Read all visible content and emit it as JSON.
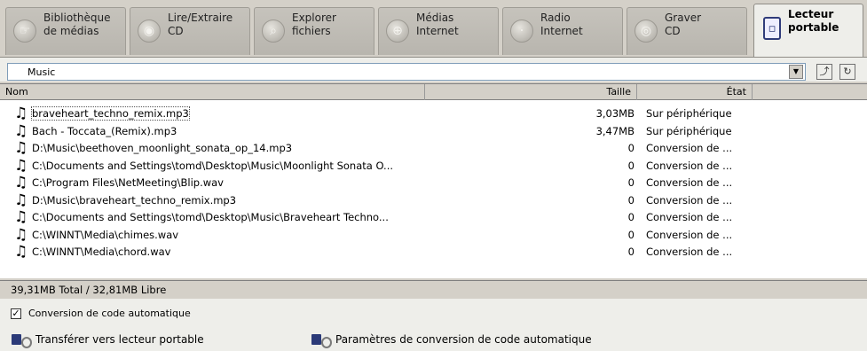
{
  "tabs": [
    {
      "line1": "Bibliothèque",
      "line2": "de médias",
      "icon": "hand-icon"
    },
    {
      "line1": "Lire/Extraire",
      "line2": "CD",
      "icon": "cd-icon"
    },
    {
      "line1": "Explorer",
      "line2": "fichiers",
      "icon": "search-icon"
    },
    {
      "line1": "Médias",
      "line2": "Internet",
      "icon": "globe-icon"
    },
    {
      "line1": "Radio",
      "line2": "Internet",
      "icon": "radio-icon"
    },
    {
      "line1": "Graver",
      "line2": "CD",
      "icon": "burn-cd-icon"
    },
    {
      "line1": "Lecteur",
      "line2": "portable",
      "icon": "portable-player-icon",
      "active": true
    }
  ],
  "folder": {
    "value": "Music"
  },
  "columns": {
    "name": "Nom",
    "size": "Taille",
    "state": "État"
  },
  "rows": [
    {
      "name": "braveheart_techno_remix.mp3",
      "size": "3,03MB",
      "state": "Sur périphérique"
    },
    {
      "name": "Bach - Toccata_(Remix).mp3",
      "size": "3,47MB",
      "state": "Sur périphérique"
    },
    {
      "name": "D:\\Music\\beethoven_moonlight_sonata_op_14.mp3",
      "size": "0",
      "state": "Conversion de ..."
    },
    {
      "name": "C:\\Documents and Settings\\tomd\\Desktop\\Music\\Moonlight Sonata O...",
      "size": "0",
      "state": "Conversion de ..."
    },
    {
      "name": "C:\\Program Files\\NetMeeting\\Blip.wav",
      "size": "0",
      "state": "Conversion de ..."
    },
    {
      "name": "D:\\Music\\braveheart_techno_remix.mp3",
      "size": "0",
      "state": "Conversion de ..."
    },
    {
      "name": "C:\\Documents and Settings\\tomd\\Desktop\\Music\\Braveheart Techno...",
      "size": "0",
      "state": "Conversion de ..."
    },
    {
      "name": "C:\\WINNT\\Media\\chimes.wav",
      "size": "0",
      "state": "Conversion de ..."
    },
    {
      "name": "C:\\WINNT\\Media\\chord.wav",
      "size": "0",
      "state": "Conversion de ..."
    }
  ],
  "status": {
    "text": "39,31MB Total / 32,81MB Libre"
  },
  "auto_convert": {
    "label": "Conversion de code automatique",
    "checked": true
  },
  "actions": {
    "transfer": "Transférer vers lecteur portable",
    "settings": "Paramètres de conversion de code automatique"
  }
}
